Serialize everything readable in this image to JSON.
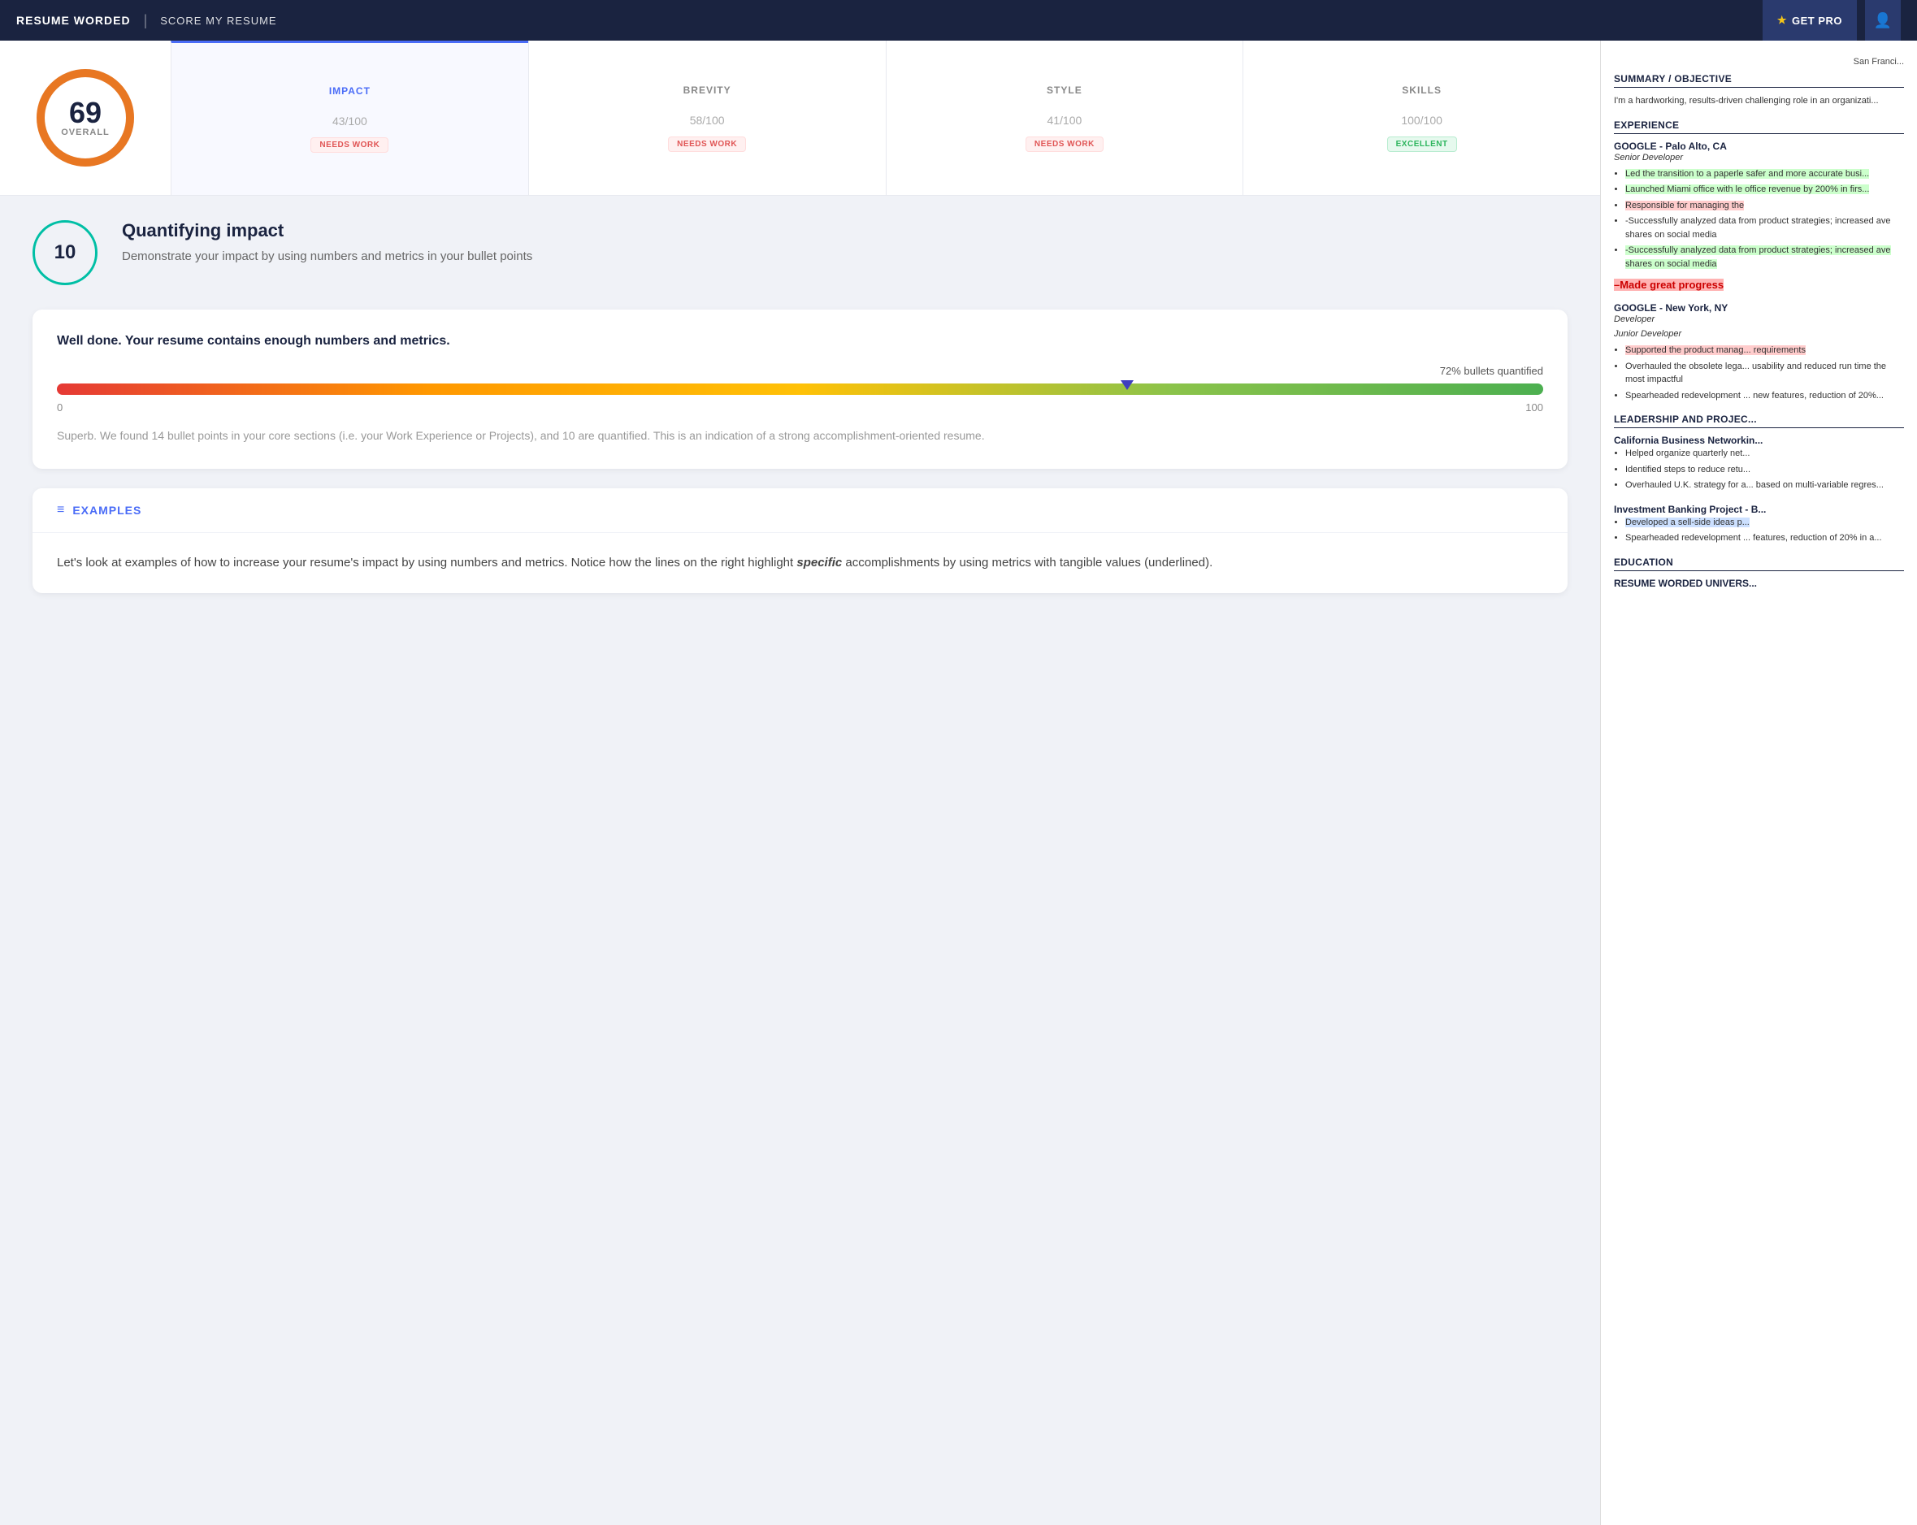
{
  "nav": {
    "brand": "RESUME WORDED",
    "divider": "|",
    "score_my_resume": "SCORE MY RESUME",
    "get_pro": "GET PRO",
    "star_icon": "★"
  },
  "overall": {
    "score": "69",
    "label": "OVERALL"
  },
  "categories": [
    {
      "name": "IMPACT",
      "score": "43",
      "max": "100",
      "badge": "NEEDS WORK",
      "badge_type": "needs-work",
      "active": true
    },
    {
      "name": "BREVITY",
      "score": "58",
      "max": "100",
      "badge": "NEEDS WORK",
      "badge_type": "needs-work",
      "active": false
    },
    {
      "name": "STYLE",
      "score": "41",
      "max": "100",
      "badge": "NEEDS WORK",
      "badge_type": "needs-work",
      "active": false
    },
    {
      "name": "SKILLS",
      "score": "100",
      "max": "100",
      "badge": "EXCELLENT",
      "badge_type": "excellent",
      "active": false
    }
  ],
  "quantifying": {
    "circle_number": "10",
    "title": "Quantifying impact",
    "description": "Demonstrate your impact by using numbers and metrics in your bullet points"
  },
  "progress_card": {
    "well_done": "Well done. Your resume contains enough numbers and metrics.",
    "progress_label": "72% bullets quantified",
    "axis_min": "0",
    "axis_max": "100",
    "superb_text": "Superb. We found 14 bullet points in your core sections (i.e. your Work Experience or Projects), and 10 are quantified. This is an indication of a strong accomplishment-oriented resume."
  },
  "examples": {
    "icon": "≡",
    "title": "EXAMPLES",
    "body": "Let's look at examples of how to increase your resume's impact by using numbers and metrics. Notice how the lines on the right highlight specific accomplishments by using metrics with tangible values (underlined)."
  },
  "resume_preview": {
    "location": "San Franci...",
    "summary_title": "SUMMARY / OBJECTIVE",
    "summary_text": "I'm a hardworking, results-driven challenging role in an organizati...",
    "experience_title": "EXPERIENCE",
    "jobs": [
      {
        "company": "GOOGLE - Palo Alto, CA",
        "role": "Senior Developer",
        "bullets": [
          {
            "text": "Led the transition to a paperle safer and more accurate busi...",
            "highlight": "green"
          },
          {
            "text": "Launched Miami office with le office revenue by 200% in firs...",
            "highlight": "green"
          },
          {
            "text": "Responsible for managing the",
            "highlight": "red"
          },
          {
            "text": "-Successfully analyzed data from product strategies; increased ave shares on social media",
            "highlight": "none"
          },
          {
            "text": "-Successfully analyzed data from product strategies; increased ave shares on social media",
            "highlight": "green"
          },
          {
            "text": "–Made great progress",
            "highlight": "strikethrough",
            "extra": "pink"
          }
        ]
      },
      {
        "company": "GOOGLE - New York, NY",
        "role1": "Developer",
        "role2": "Junior Developer",
        "bullets": [
          {
            "text": "Supported the product manag... requirements",
            "highlight": "red"
          },
          {
            "text": "Overhauled the obsolete lega... usability and reduced run time the most impactful",
            "highlight": "none"
          },
          {
            "text": "Spearheaded redevelopment ... new features, reduction of 20%...",
            "highlight": "none"
          }
        ]
      }
    ],
    "leadership_title": "LEADERSHIP AND PROJEC...",
    "leadership_items": [
      {
        "company": "California Business Networkin...",
        "bullets": [
          {
            "text": "Helped organize quarterly net...",
            "highlight": "none"
          },
          {
            "text": "Identified steps to reduce retu...",
            "highlight": "none"
          },
          {
            "text": "Overhauled U.K. strategy for a... based on multi-variable regres...",
            "highlight": "none"
          }
        ]
      },
      {
        "company": "Investment Banking Project - B...",
        "bullets": [
          {
            "text": "Developed a sell-side ideas p...",
            "highlight": "blue"
          },
          {
            "text": "Spearheaded redevelopment ... features, reduction of 20% in a...",
            "highlight": "none"
          }
        ]
      }
    ],
    "education_title": "EDUCATION",
    "education_items": [
      {
        "company": "RESUME WORDED UNIVERS..."
      }
    ]
  }
}
